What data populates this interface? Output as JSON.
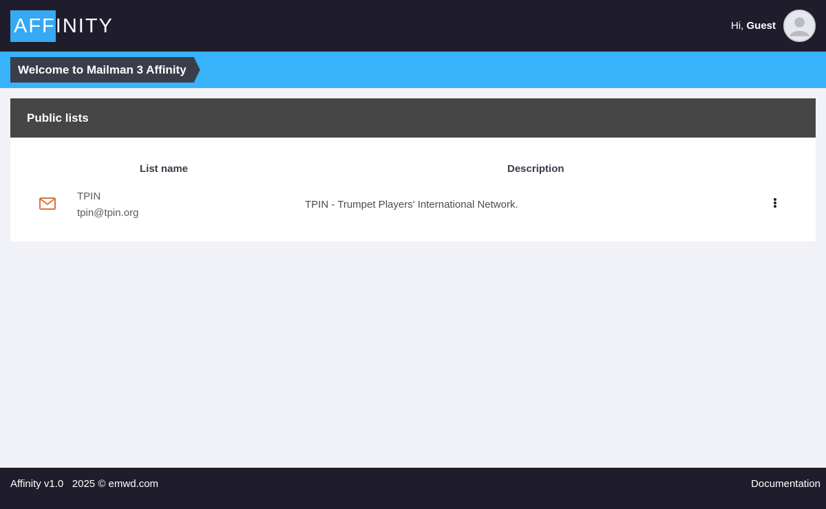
{
  "header": {
    "logo_highlight": "AFF",
    "logo_rest": "INITY",
    "greeting_prefix": "Hi, ",
    "greeting_user": "Guest"
  },
  "banner": {
    "title": "Welcome to Mailman 3 Affinity"
  },
  "lists_card": {
    "title": "Public lists",
    "columns": [
      "List name",
      "Description"
    ],
    "rows": [
      {
        "name": "TPIN",
        "address": "tpin@tpin.org",
        "description": "TPIN - Trumpet Players' International Network."
      }
    ]
  },
  "footer": {
    "version": "Affinity v1.0",
    "copyright": "2025 © emwd.com",
    "documentation_link": "Documentation"
  },
  "colors": {
    "topbar": "#1f1d2b",
    "accent": "#38b2fa",
    "card_header": "#464646",
    "mail_icon": "#e0703c"
  },
  "icons": {
    "avatar": "user-avatar-icon",
    "mail": "envelope-icon",
    "menu": "kebab-menu-icon"
  }
}
